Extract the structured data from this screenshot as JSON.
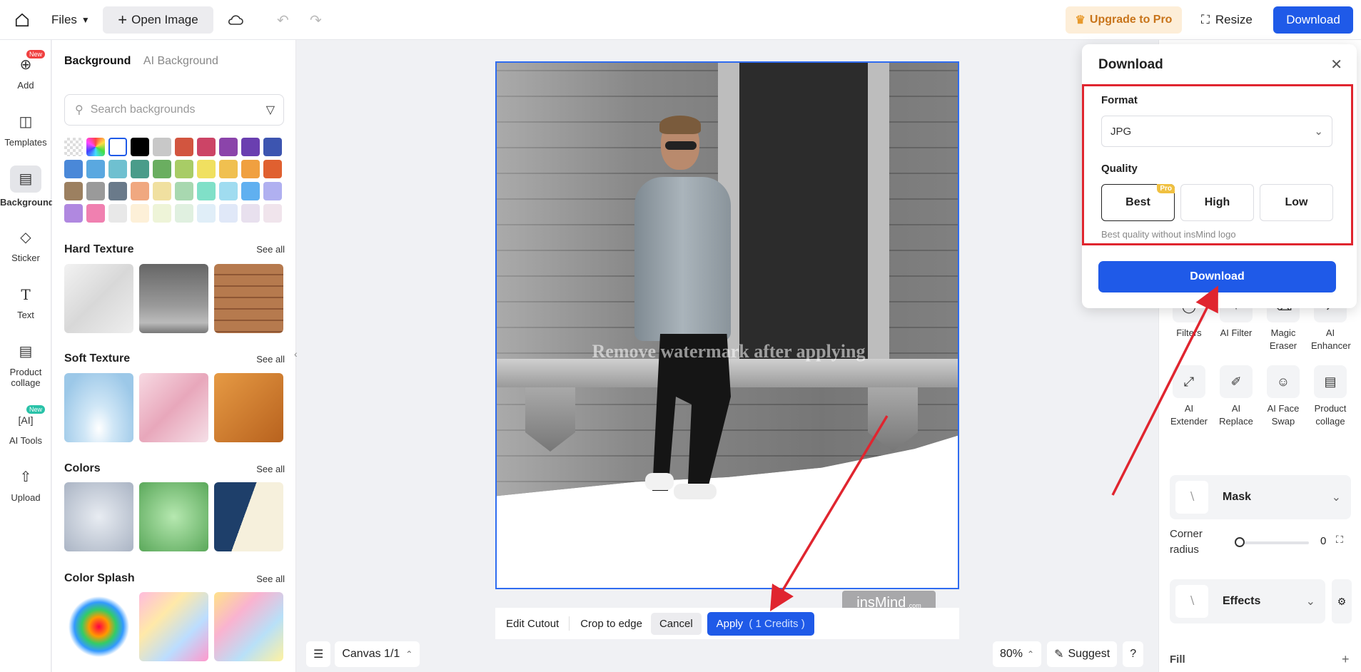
{
  "topbar": {
    "files_label": "Files",
    "open_image_label": "Open Image",
    "upgrade_label": "Upgrade to Pro",
    "resize_label": "Resize",
    "download_label": "Download"
  },
  "leftnav": {
    "items": [
      {
        "label": "Add",
        "badge": "New"
      },
      {
        "label": "Templates"
      },
      {
        "label": "Background"
      },
      {
        "label": "Sticker"
      },
      {
        "label": "Text"
      },
      {
        "label": "Product collage"
      },
      {
        "label": "AI Tools",
        "badge": "New"
      },
      {
        "label": "Upload"
      }
    ]
  },
  "panel": {
    "tab_background": "Background",
    "tab_ai_background": "AI Background",
    "search_placeholder": "Search backgrounds",
    "swatch_colors": [
      "#e8e8e8",
      "rainbow",
      "#ffffff",
      "#000000",
      "#c8c8c8",
      "#d2553f",
      "#cc4466",
      "#8b44aa",
      "#6a3fb0",
      "#3d55b0",
      "#4a88d8",
      "#5aa8e0",
      "#6fc0d0",
      "#4a9c8a",
      "#6aae60",
      "#a8cc66",
      "#f0e060",
      "#f0c050",
      "#f0a040",
      "#e06030",
      "#9c8060",
      "#9a9a9a",
      "#6a7a8a",
      "#f0a880",
      "#f0e0a0",
      "#a8d8b0",
      "#80e0c8",
      "#a0dcf0",
      "#60b0f0",
      "#b0b0f0",
      "#b088e0",
      "#f080b0",
      "#e8e8e8",
      "#fdf0d8",
      "#eef4d8",
      "#e0f0e0",
      "#e0eef8",
      "#e0e8f8",
      "#e8e0ee",
      "#f0e4ec"
    ],
    "sections": [
      {
        "title": "Hard Texture",
        "see_all": "See all"
      },
      {
        "title": "Soft Texture",
        "see_all": "See all"
      },
      {
        "title": "Colors",
        "see_all": "See all"
      },
      {
        "title": "Color Splash",
        "see_all": "See all"
      }
    ]
  },
  "canvas": {
    "watermark": "Remove watermark after applying",
    "logo": "insMind",
    "logo_suffix": ".com"
  },
  "actionbar": {
    "edit_cutout": "Edit Cutout",
    "crop_to_edge": "Crop to edge",
    "cancel": "Cancel",
    "apply": "Apply",
    "credits": "( 1 Credits )"
  },
  "bottom": {
    "canvas_label": "Canvas 1/1",
    "zoom": "80%",
    "suggest": "Suggest",
    "help": "?"
  },
  "rightpanel": {
    "tools": [
      {
        "label": "Filters"
      },
      {
        "label": "AI Filter"
      },
      {
        "label": "Magic Eraser"
      },
      {
        "label": "AI Enhancer"
      },
      {
        "label": "AI Extender"
      },
      {
        "label": "AI Replace"
      },
      {
        "label": "AI Face Swap"
      },
      {
        "label": "Product collage"
      }
    ],
    "mask_label": "Mask",
    "corner_radius_label": "Corner radius",
    "corner_radius_value": "0",
    "effects_label": "Effects",
    "fill_label": "Fill"
  },
  "download_popup": {
    "title": "Download",
    "format_label": "Format",
    "format_value": "JPG",
    "quality_label": "Quality",
    "quality_options": [
      {
        "label": "Best",
        "badge": "Pro",
        "selected": true
      },
      {
        "label": "High",
        "selected": false
      },
      {
        "label": "Low",
        "selected": false
      }
    ],
    "quality_note": "Best quality without insMind logo",
    "download_button": "Download"
  },
  "colors": {
    "accent": "#1f5ae8",
    "annotation_red": "#e0252f"
  }
}
